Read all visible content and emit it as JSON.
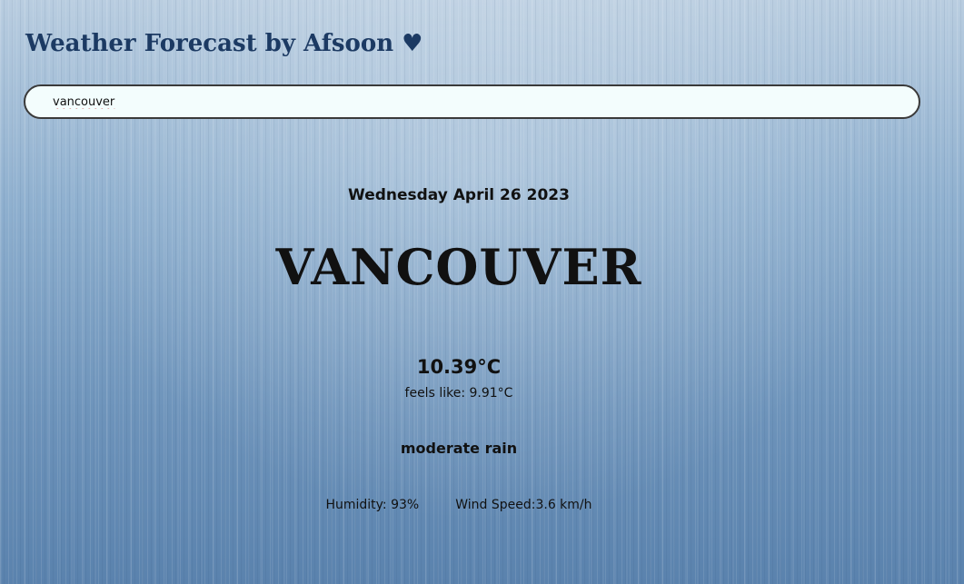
{
  "header": {
    "title": "Weather Forecast by Afsoon ♥"
  },
  "search": {
    "value": "vancouver",
    "placeholder": ""
  },
  "weather": {
    "date": "Wednesday April 26 2023",
    "city": "VANCOUVER",
    "temperature": "10.39°C",
    "feels_like_label": "feels like:",
    "feels_like_value": "9.91°C",
    "description": "moderate rain",
    "humidity_label": "Humidity:",
    "humidity_value": "93%",
    "wind_label": "Wind Speed:",
    "wind_value": "3.6 km/h"
  },
  "colors": {
    "title": "#1c3a63",
    "search_bg": "#f3fdfd",
    "text": "#111111",
    "background_top": "#b9cde0",
    "background_bottom": "#5a82ad"
  }
}
